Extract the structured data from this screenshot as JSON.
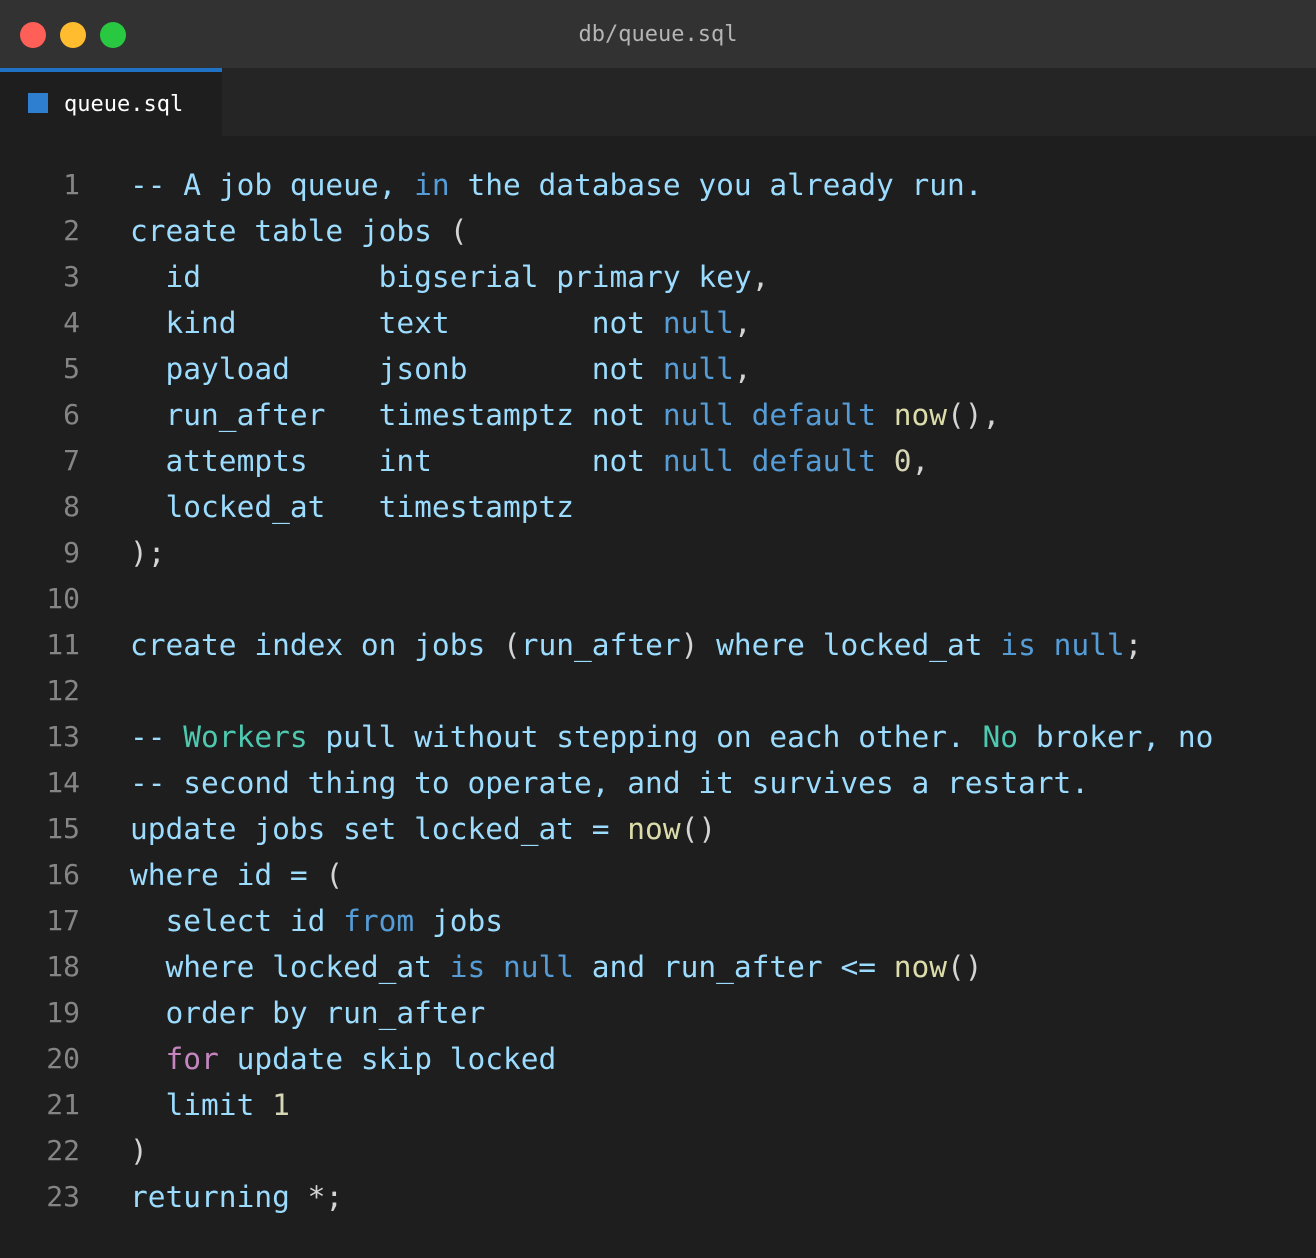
{
  "window": {
    "title": "db/queue.sql"
  },
  "tab": {
    "label": "queue.sql",
    "icon": "sql-file-icon",
    "active_color": "#1f72c4"
  },
  "colors": {
    "background": "#1e1e1e",
    "identifier": "#9cdcfe",
    "keyword": "#569cd6",
    "function": "#dcdcaa",
    "type": "#4ec9b0",
    "control": "#c586c0",
    "line_number": "#858585"
  },
  "editor": {
    "lines": [
      {
        "number": "1",
        "tokens": [
          {
            "t": "-- A job queue, ",
            "c": "comment"
          },
          {
            "t": "in",
            "c": "kw"
          },
          {
            "t": " the database you already run.",
            "c": "comment"
          }
        ]
      },
      {
        "number": "2",
        "tokens": [
          {
            "t": "create table jobs ",
            "c": "plain"
          },
          {
            "t": "(",
            "c": "punct"
          }
        ]
      },
      {
        "number": "3",
        "tokens": [
          {
            "t": "  id          bigserial primary key",
            "c": "plain"
          },
          {
            "t": ",",
            "c": "punct"
          }
        ]
      },
      {
        "number": "4",
        "tokens": [
          {
            "t": "  kind        text        not ",
            "c": "plain"
          },
          {
            "t": "null",
            "c": "kw"
          },
          {
            "t": ",",
            "c": "punct"
          }
        ]
      },
      {
        "number": "5",
        "tokens": [
          {
            "t": "  payload     jsonb       not ",
            "c": "plain"
          },
          {
            "t": "null",
            "c": "kw"
          },
          {
            "t": ",",
            "c": "punct"
          }
        ]
      },
      {
        "number": "6",
        "tokens": [
          {
            "t": "  run_after   timestamptz not ",
            "c": "plain"
          },
          {
            "t": "null default ",
            "c": "kw"
          },
          {
            "t": "now",
            "c": "fn"
          },
          {
            "t": "(),",
            "c": "punct"
          }
        ]
      },
      {
        "number": "7",
        "tokens": [
          {
            "t": "  attempts    int         not ",
            "c": "plain"
          },
          {
            "t": "null default ",
            "c": "kw"
          },
          {
            "t": "0",
            "c": "num"
          },
          {
            "t": ",",
            "c": "punct"
          }
        ]
      },
      {
        "number": "8",
        "tokens": [
          {
            "t": "  locked_at   timestamptz",
            "c": "plain"
          }
        ]
      },
      {
        "number": "9",
        "tokens": [
          {
            "t": ");",
            "c": "punct"
          }
        ]
      },
      {
        "number": "10",
        "tokens": []
      },
      {
        "number": "11",
        "tokens": [
          {
            "t": "create index on jobs ",
            "c": "plain"
          },
          {
            "t": "(",
            "c": "punct"
          },
          {
            "t": "run_after",
            "c": "plain"
          },
          {
            "t": ")",
            "c": "punct"
          },
          {
            "t": " where locked_at ",
            "c": "plain"
          },
          {
            "t": "is null",
            "c": "kw"
          },
          {
            "t": ";",
            "c": "punct"
          }
        ]
      },
      {
        "number": "12",
        "tokens": []
      },
      {
        "number": "13",
        "tokens": [
          {
            "t": "-- ",
            "c": "comment"
          },
          {
            "t": "Workers",
            "c": "type"
          },
          {
            "t": " pull without stepping on each other. ",
            "c": "comment"
          },
          {
            "t": "No",
            "c": "type"
          },
          {
            "t": " broker, no",
            "c": "comment"
          }
        ]
      },
      {
        "number": "14",
        "tokens": [
          {
            "t": "-- second thing to operate, and it survives a restart.",
            "c": "comment"
          }
        ]
      },
      {
        "number": "15",
        "tokens": [
          {
            "t": "update jobs set locked_at = ",
            "c": "plain"
          },
          {
            "t": "now",
            "c": "fn"
          },
          {
            "t": "()",
            "c": "punct"
          }
        ]
      },
      {
        "number": "16",
        "tokens": [
          {
            "t": "where id = ",
            "c": "plain"
          },
          {
            "t": "(",
            "c": "punct"
          }
        ]
      },
      {
        "number": "17",
        "tokens": [
          {
            "t": "  select id ",
            "c": "plain"
          },
          {
            "t": "from",
            "c": "kw"
          },
          {
            "t": " jobs",
            "c": "plain"
          }
        ]
      },
      {
        "number": "18",
        "tokens": [
          {
            "t": "  where locked_at ",
            "c": "plain"
          },
          {
            "t": "is null",
            "c": "kw"
          },
          {
            "t": " and run_after <= ",
            "c": "plain"
          },
          {
            "t": "now",
            "c": "fn"
          },
          {
            "t": "()",
            "c": "punct"
          }
        ]
      },
      {
        "number": "19",
        "tokens": [
          {
            "t": "  order by run_after",
            "c": "plain"
          }
        ]
      },
      {
        "number": "20",
        "tokens": [
          {
            "t": "  ",
            "c": "plain"
          },
          {
            "t": "for",
            "c": "ctrl"
          },
          {
            "t": " update skip locked",
            "c": "plain"
          }
        ]
      },
      {
        "number": "21",
        "tokens": [
          {
            "t": "  limit ",
            "c": "plain"
          },
          {
            "t": "1",
            "c": "num"
          }
        ]
      },
      {
        "number": "22",
        "tokens": [
          {
            "t": ")",
            "c": "punct"
          }
        ]
      },
      {
        "number": "23",
        "tokens": [
          {
            "t": "returning ",
            "c": "plain"
          },
          {
            "t": "*;",
            "c": "punct"
          }
        ]
      }
    ]
  }
}
